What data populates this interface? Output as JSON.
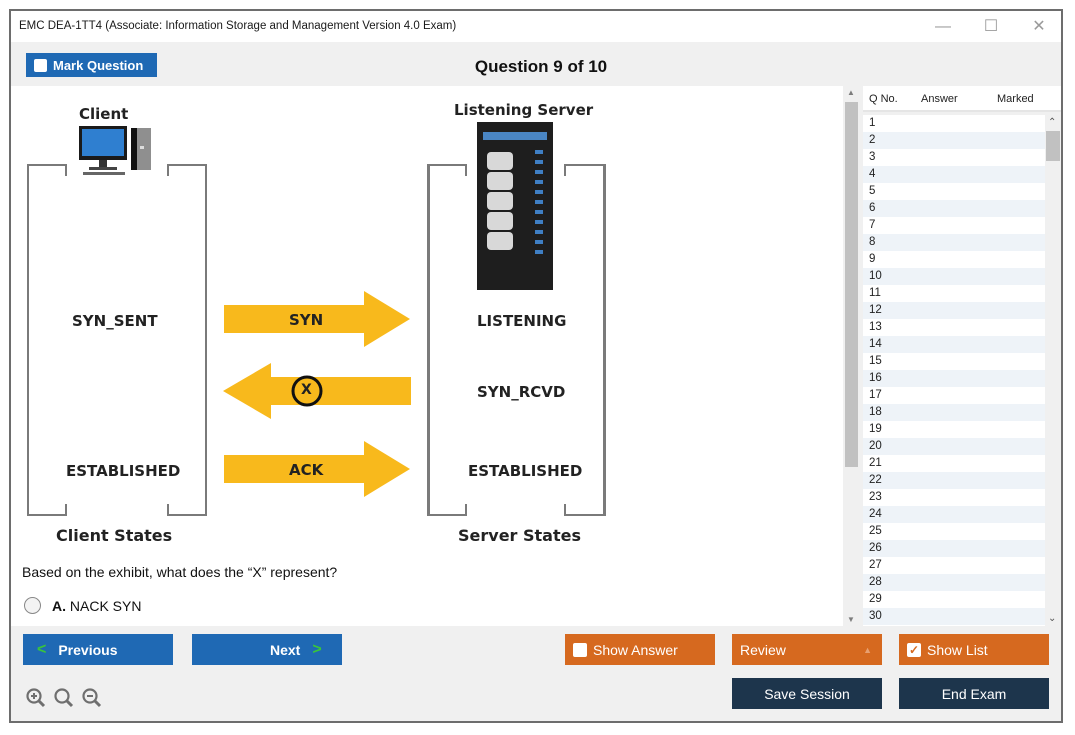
{
  "window": {
    "title": "EMC DEA-1TT4 (Associate: Information Storage and Management Version 4.0 Exam)",
    "controls": {
      "minimize": "—",
      "maximize": "☐",
      "close": "✕"
    }
  },
  "header": {
    "mark_question_label": "Mark Question",
    "question_counter": "Question 9 of 10"
  },
  "exhibit": {
    "client_title": "Client",
    "server_title": "Listening Server",
    "client_states": [
      "SYN_SENT",
      "ESTABLISHED"
    ],
    "server_states": [
      "LISTENING",
      "SYN_RCVD",
      "ESTABLISHED"
    ],
    "arrows": [
      {
        "label": "SYN",
        "direction": "right"
      },
      {
        "label": "X",
        "direction": "left"
      },
      {
        "label": "ACK",
        "direction": "right"
      }
    ],
    "client_footer": "Client States",
    "server_footer": "Server States",
    "arrow_color": "#f8b91c"
  },
  "question": {
    "text": "Based on the exhibit, what does the “X” represent?",
    "options": [
      {
        "letter": "A.",
        "text": "NACK SYN",
        "selected": false
      }
    ]
  },
  "question_list": {
    "headers": {
      "qno": "Q No.",
      "answer": "Answer",
      "marked": "Marked"
    },
    "rows": [
      "1",
      "2",
      "3",
      "4",
      "5",
      "6",
      "7",
      "8",
      "9",
      "10",
      "11",
      "12",
      "13",
      "14",
      "15",
      "16",
      "17",
      "18",
      "19",
      "20",
      "21",
      "22",
      "23",
      "24",
      "25",
      "26",
      "27",
      "28",
      "29",
      "30"
    ]
  },
  "footer": {
    "previous_label": "Previous",
    "next_label": "Next",
    "show_answer_label": "Show Answer",
    "show_answer_checked": false,
    "review_label": "Review",
    "show_list_label": "Show List",
    "show_list_checked": true,
    "save_session_label": "Save Session",
    "end_exam_label": "End Exam"
  },
  "colors": {
    "primary_blue": "#1f69b4",
    "orange": "#d6691f",
    "dark_navy": "#1d354c",
    "chevron_green": "#39c53b"
  }
}
